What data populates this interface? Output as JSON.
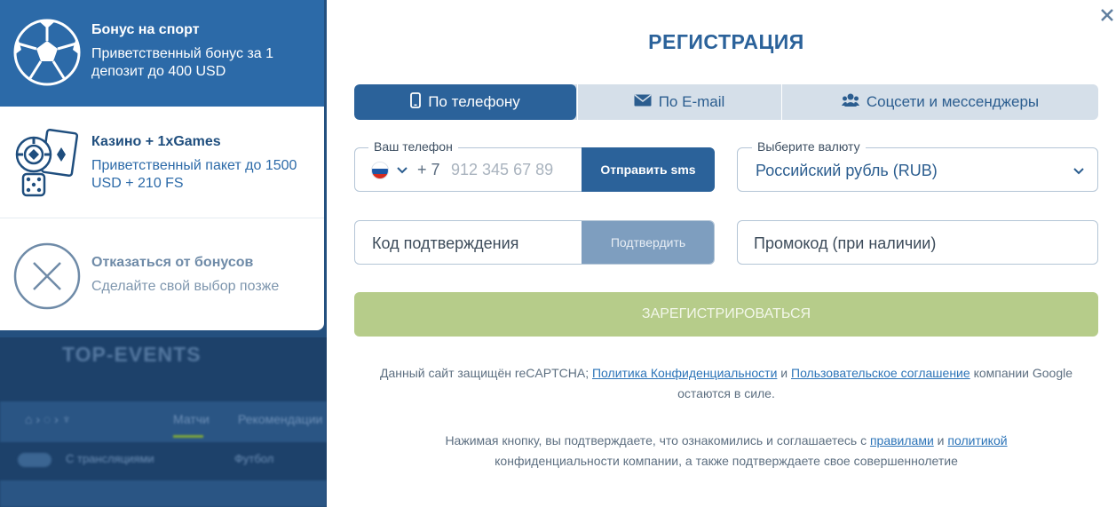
{
  "background": {
    "title": "TOP-EVENTS",
    "tab_matches": "Матчи",
    "tab_more": "Рекомендации",
    "with_streams": "С трансляциями",
    "football": "Футбол"
  },
  "bonuses": [
    {
      "title": "Бонус на спорт",
      "desc": "Приветственный бонус за 1 депозит до 400 USD",
      "icon": "soccer-ball-icon"
    },
    {
      "title": "Казино + 1xGames",
      "desc": "Приветственный пакет до 1500 USD + 210 FS",
      "icon": "casino-chips-icon"
    },
    {
      "title": "Отказаться от бонусов",
      "desc": "Сделайте свой выбор позже",
      "icon": "decline-x-icon"
    }
  ],
  "modal": {
    "title": "РЕГИСТРАЦИЯ",
    "tabs": [
      {
        "label": "По телефону",
        "icon": "phone-icon",
        "active": true
      },
      {
        "label": "По E-mail",
        "icon": "envelope-icon",
        "active": false
      },
      {
        "label": "Соцсети и мессенджеры",
        "icon": "users-icon",
        "active": false
      }
    ],
    "phone": {
      "legend": "Ваш телефон",
      "country_code": "+ 7",
      "placeholder": "912 345 67 89",
      "send_label": "Отправить sms"
    },
    "currency": {
      "legend": "Выберите валюту",
      "value": "Российский рубль (RUB)"
    },
    "code": {
      "placeholder": "Код подтверждения",
      "confirm_label": "Подтвердить"
    },
    "promo": {
      "placeholder": "Промокод (при наличии)"
    },
    "register_label": "ЗАРЕГИСТРИРОВАТЬСЯ",
    "recaptcha": {
      "prefix": "Данный сайт защищён reCAPTCHA;",
      "privacy_link": "Политика Конфиденциальности",
      "and": "и",
      "terms_link": "Пользовательское соглашение",
      "suffix": "компании Google остаются в силе."
    },
    "consent": {
      "prefix": "Нажимая кнопку, вы подтверждаете, что ознакомились и соглашаетесь с",
      "rules_link": "правилами",
      "and": "и",
      "policy_link": "политикой",
      "suffix": "конфиденциальности компании, а также подтверждаете свое совершеннолетие"
    }
  },
  "colors": {
    "brand_blue": "#2b629a",
    "register_green": "#b6cc8a",
    "link_blue": "#2c74b8"
  }
}
